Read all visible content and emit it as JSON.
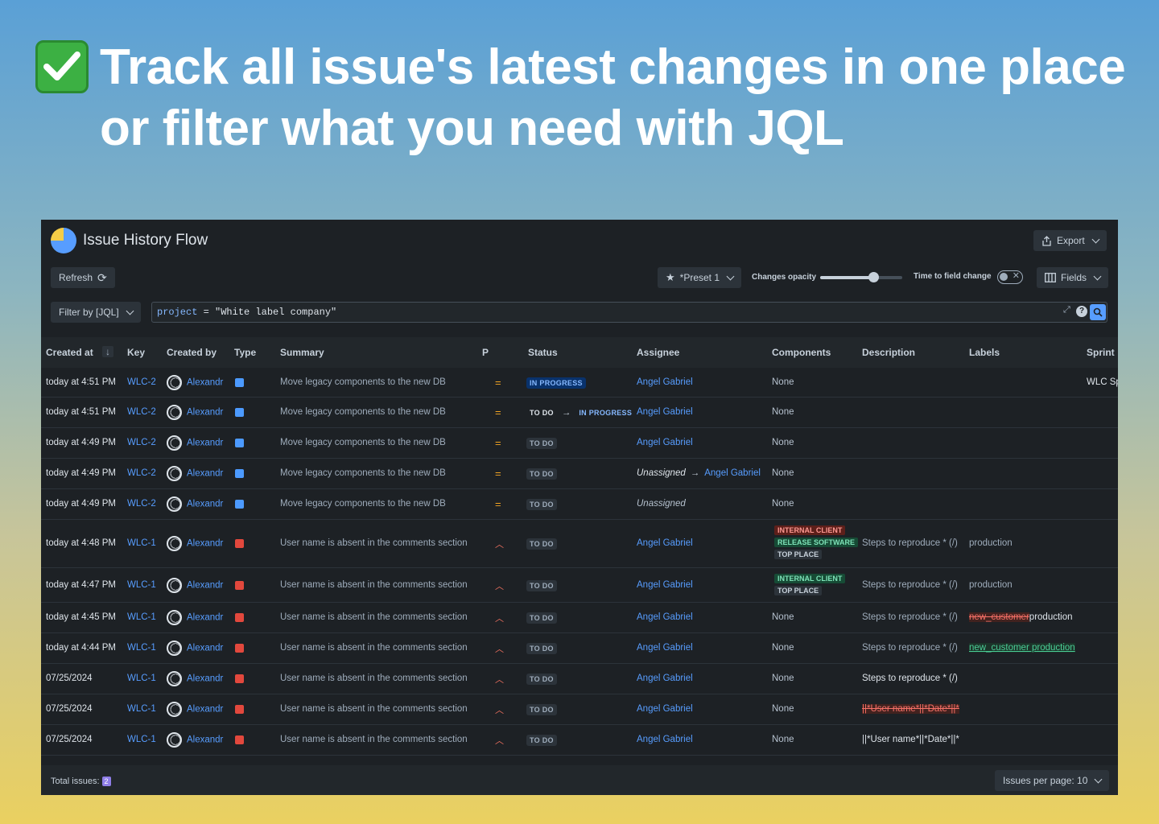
{
  "hero": {
    "title_line1": "Track all issue's latest changes in one place",
    "title_line2": "or filter what you need with JQL"
  },
  "app": {
    "title": "Issue History Flow",
    "export_label": "Export",
    "refresh_label": "Refresh",
    "preset_label": "*Preset 1",
    "opacity_label": "Changes opacity",
    "opacity_value": 0.65,
    "time_label": "Time to field change",
    "fields_label": "Fields",
    "filter_label": "Filter by [JQL]",
    "jql_keyword": "project",
    "jql_rest": " = \"White label company\""
  },
  "columns": [
    "Created at",
    "Key",
    "Created by",
    "Type",
    "Summary",
    "P",
    "Status",
    "Assignee",
    "Components",
    "Description",
    "Labels",
    "Sprint"
  ],
  "rows": [
    {
      "created": "today at 4:51 PM",
      "key": "WLC-2",
      "by": "Alexandr",
      "type": "task",
      "summary": "Move legacy components to the new DB",
      "prio": "=",
      "status_from": "",
      "status": "IN PROGRESS",
      "status_kind": "prog",
      "assignee_from": "",
      "assignee": "Angel Gabriel",
      "components": "None",
      "description": "",
      "labels": "",
      "sprint": "WLC Sp"
    },
    {
      "created": "today at 4:51 PM",
      "key": "WLC-2",
      "by": "Alexandr",
      "type": "task",
      "summary": "Move legacy components to the new DB",
      "prio": "=",
      "status_from": "TO DO",
      "status": "IN PROGRESS",
      "status_kind": "prog",
      "assignee_from": "",
      "assignee": "Angel Gabriel",
      "components": "None",
      "description": "",
      "labels": "",
      "sprint": ""
    },
    {
      "created": "today at 4:49 PM",
      "key": "WLC-2",
      "by": "Alexandr",
      "type": "task",
      "summary": "Move legacy components to the new DB",
      "prio": "=",
      "status_from": "",
      "status": "TO DO",
      "status_kind": "todo",
      "assignee_from": "",
      "assignee": "Angel Gabriel",
      "components": "None",
      "description": "",
      "labels": "",
      "sprint": ""
    },
    {
      "created": "today at 4:49 PM",
      "key": "WLC-2",
      "by": "Alexandr",
      "type": "task",
      "summary": "Move legacy components to the new DB",
      "prio": "=",
      "status_from": "",
      "status": "TO DO",
      "status_kind": "todo",
      "assignee_from": "Unassigned",
      "assignee": "Angel Gabriel",
      "components": "None",
      "description": "",
      "labels": "",
      "sprint": ""
    },
    {
      "created": "today at 4:49 PM",
      "key": "WLC-2",
      "by": "Alexandr",
      "type": "task",
      "summary": "Move legacy components to the new DB",
      "prio": "=",
      "status_from": "",
      "status": "TO DO",
      "status_kind": "todo",
      "assignee_from": "",
      "assignee": "Unassigned",
      "components": "None",
      "description": "",
      "labels": "",
      "sprint": ""
    },
    {
      "created": "today at 4:48 PM",
      "key": "WLC-1",
      "by": "Alexandr",
      "type": "bug",
      "summary": "User name is absent in the comments section",
      "prio": "^",
      "status_from": "",
      "status": "TO DO",
      "status_kind": "todo",
      "assignee_from": "",
      "assignee": "Angel Gabriel",
      "components_tags": [
        {
          "text": "INTERNAL CLIENT",
          "kind": "red"
        },
        {
          "text": "RELEASE SOFTWARE",
          "kind": "green"
        },
        {
          "text": "TOP PLACE",
          "kind": "plain"
        }
      ],
      "description": "Steps to reproduce * (/)",
      "labels": "production",
      "sprint": ""
    },
    {
      "created": "today at 4:47 PM",
      "key": "WLC-1",
      "by": "Alexandr",
      "type": "bug",
      "summary": "User name is absent in the comments section",
      "prio": "^",
      "status_from": "",
      "status": "TO DO",
      "status_kind": "todo",
      "assignee_from": "",
      "assignee": "Angel Gabriel",
      "components_tags": [
        {
          "text": "INTERNAL CLIENT",
          "kind": "green"
        },
        {
          "text": "TOP PLACE",
          "kind": "plain"
        }
      ],
      "description": "Steps to reproduce * (/)",
      "labels": "production",
      "sprint": ""
    },
    {
      "created": "today at 4:45 PM",
      "key": "WLC-1",
      "by": "Alexandr",
      "type": "bug",
      "summary": "User name is absent in the comments section",
      "prio": "^",
      "status_from": "",
      "status": "TO DO",
      "status_kind": "todo",
      "assignee_from": "",
      "assignee": "Angel Gabriel",
      "components": "None",
      "description": "Steps to reproduce * (/)",
      "labels_removed": "new_customer",
      "labels": "production",
      "sprint": ""
    },
    {
      "created": "today at 4:44 PM",
      "key": "WLC-1",
      "by": "Alexandr",
      "type": "bug",
      "summary": "User name is absent in the comments section",
      "prio": "^",
      "status_from": "",
      "status": "TO DO",
      "status_kind": "todo",
      "assignee_from": "",
      "assignee": "Angel Gabriel",
      "components": "None",
      "description": "Steps to reproduce * (/)",
      "labels_added": "new_customer production",
      "labels": "",
      "sprint": ""
    },
    {
      "created": "07/25/2024",
      "key": "WLC-1",
      "by": "Alexandr",
      "type": "bug",
      "summary": "User name is absent in the comments section",
      "prio": "^",
      "status_from": "",
      "status": "TO DO",
      "status_kind": "todo",
      "assignee_from": "",
      "assignee": "Angel Gabriel",
      "components": "None",
      "description": "Steps to reproduce * (/)",
      "desc_bright": true,
      "labels": "",
      "sprint": ""
    },
    {
      "created": "07/25/2024",
      "key": "WLC-1",
      "by": "Alexandr",
      "type": "bug",
      "summary": "User name is absent in the comments section",
      "prio": "^",
      "status_from": "",
      "status": "TO DO",
      "status_kind": "todo",
      "assignee_from": "",
      "assignee": "Angel Gabriel",
      "components": "None",
      "description_removed": "||*User name*||*Date*||*",
      "labels": "",
      "sprint": ""
    },
    {
      "created": "07/25/2024",
      "key": "WLC-1",
      "by": "Alexandr",
      "type": "bug",
      "summary": "User name is absent in the comments section",
      "prio": "^",
      "status_from": "",
      "status": "TO DO",
      "status_kind": "todo",
      "assignee_from": "",
      "assignee": "Angel Gabriel",
      "components": "None",
      "description": "||*User name*||*Date*||*",
      "desc_bright": true,
      "labels": "",
      "sprint": ""
    }
  ],
  "footer": {
    "total_label": "Total issues:",
    "total_value": "2",
    "per_page_label": "Issues per page: 10"
  },
  "colors": {
    "panel_bg": "#1d2125",
    "link": "#579dff",
    "accent_yellow": "#f5cd47"
  }
}
